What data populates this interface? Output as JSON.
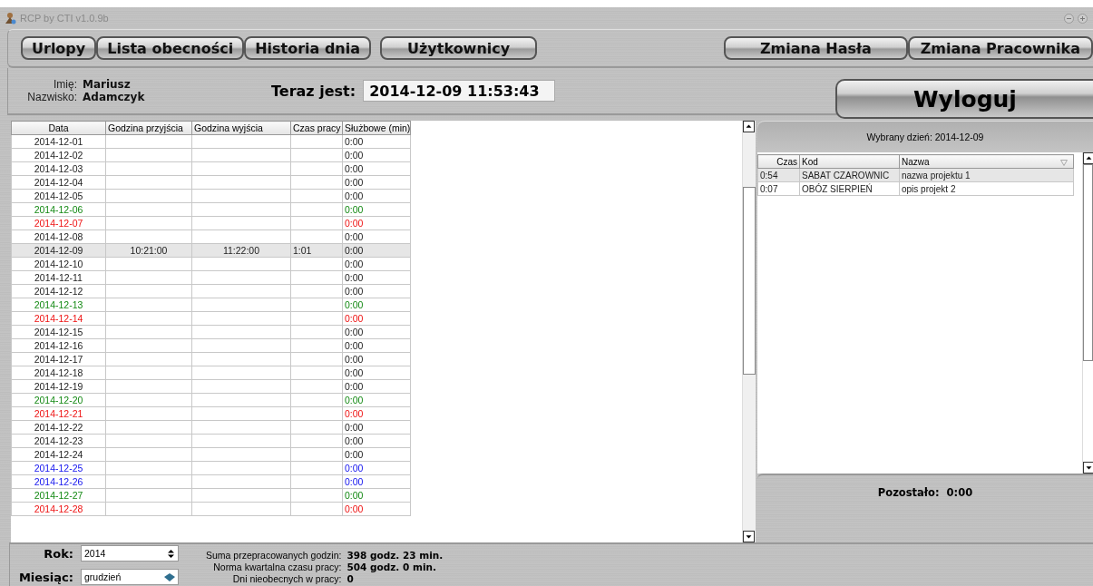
{
  "window": {
    "title": "RCP by CTI v1.0.9b"
  },
  "nav_buttons": [
    "Urlopy",
    "Lista obecności",
    "Historia dnia",
    "Użytkownicy"
  ],
  "account_buttons": [
    "Zmiana Hasła",
    "Zmiana Pracownika"
  ],
  "user": {
    "first_name_label": "Imię:",
    "first_name": "Mariusz",
    "last_name_label": "Nazwisko:",
    "last_name": "Adamczyk"
  },
  "clock": {
    "label": "Teraz jest:",
    "value": "2014-12-09 11:53:43"
  },
  "logout_button": "Wyloguj",
  "attendance_table": {
    "columns": [
      "Data",
      "Godzina przyjścia",
      "Godzina wyjścia",
      "Czas pracy",
      "Służbowe (min)"
    ],
    "rows": [
      {
        "date": "2014-12-01",
        "official": "0:00",
        "kind": "workday",
        "selected": false
      },
      {
        "date": "2014-12-02",
        "official": "0:00",
        "kind": "workday",
        "selected": false
      },
      {
        "date": "2014-12-03",
        "official": "0:00",
        "kind": "workday",
        "selected": false
      },
      {
        "date": "2014-12-04",
        "official": "0:00",
        "kind": "workday",
        "selected": false
      },
      {
        "date": "2014-12-05",
        "official": "0:00",
        "kind": "workday",
        "selected": false
      },
      {
        "date": "2014-12-06",
        "official": "0:00",
        "kind": "saturday",
        "selected": false
      },
      {
        "date": "2014-12-07",
        "official": "0:00",
        "kind": "sunday",
        "selected": false
      },
      {
        "date": "2014-12-08",
        "official": "0:00",
        "kind": "workday",
        "selected": false
      },
      {
        "date": "2014-12-09",
        "arrival": "10:21:00",
        "departure": "11:22:00",
        "work_time": "1:01",
        "official": "0:00",
        "kind": "workday",
        "selected": true
      },
      {
        "date": "2014-12-10",
        "official": "0:00",
        "kind": "workday",
        "selected": false
      },
      {
        "date": "2014-12-11",
        "official": "0:00",
        "kind": "workday",
        "selected": false
      },
      {
        "date": "2014-12-12",
        "official": "0:00",
        "kind": "workday",
        "selected": false
      },
      {
        "date": "2014-12-13",
        "official": "0:00",
        "kind": "saturday",
        "selected": false
      },
      {
        "date": "2014-12-14",
        "official": "0:00",
        "kind": "sunday",
        "selected": false
      },
      {
        "date": "2014-12-15",
        "official": "0:00",
        "kind": "workday",
        "selected": false
      },
      {
        "date": "2014-12-16",
        "official": "0:00",
        "kind": "workday",
        "selected": false
      },
      {
        "date": "2014-12-17",
        "official": "0:00",
        "kind": "workday",
        "selected": false
      },
      {
        "date": "2014-12-18",
        "official": "0:00",
        "kind": "workday",
        "selected": false
      },
      {
        "date": "2014-12-19",
        "official": "0:00",
        "kind": "workday",
        "selected": false
      },
      {
        "date": "2014-12-20",
        "official": "0:00",
        "kind": "saturday",
        "selected": false
      },
      {
        "date": "2014-12-21",
        "official": "0:00",
        "kind": "sunday",
        "selected": false
      },
      {
        "date": "2014-12-22",
        "official": "0:00",
        "kind": "workday",
        "selected": false
      },
      {
        "date": "2014-12-23",
        "official": "0:00",
        "kind": "workday",
        "selected": false
      },
      {
        "date": "2014-12-24",
        "official": "0:00",
        "kind": "workday",
        "selected": false
      },
      {
        "date": "2014-12-25",
        "official": "0:00",
        "kind": "holiday",
        "selected": false
      },
      {
        "date": "2014-12-26",
        "official": "0:00",
        "kind": "holiday",
        "selected": false
      },
      {
        "date": "2014-12-27",
        "official": "0:00",
        "kind": "saturday",
        "selected": false
      },
      {
        "date": "2014-12-28",
        "official": "0:00",
        "kind": "sunday",
        "selected": false
      }
    ]
  },
  "day_panel": {
    "title": "Wybrany dzień: 2014-12-09",
    "columns": [
      "Czas",
      "Kod",
      "Nazwa"
    ],
    "rows": [
      {
        "time": "0:54",
        "code": "SABAT CZAROWNIC",
        "name": "nazwa projektu 1",
        "selected": true
      },
      {
        "time": "0:07",
        "code": "OBÓZ SIERPIEŃ",
        "name": "opis projekt 2",
        "selected": false
      }
    ],
    "remaining": "Pozostało:  0:00"
  },
  "filters": {
    "year_label": "Rok:",
    "year": "2014",
    "month_label": "Miesiąc:",
    "month": "grudzień"
  },
  "summary": [
    {
      "label": "Suma przepracowanych godzin:",
      "value": "398 godz. 23 min."
    },
    {
      "label": "Norma kwartalna czasu pracy:",
      "value": "504 godz. 0 min."
    },
    {
      "label": "Dni nieobecnych w pracy:",
      "value": "0"
    }
  ]
}
